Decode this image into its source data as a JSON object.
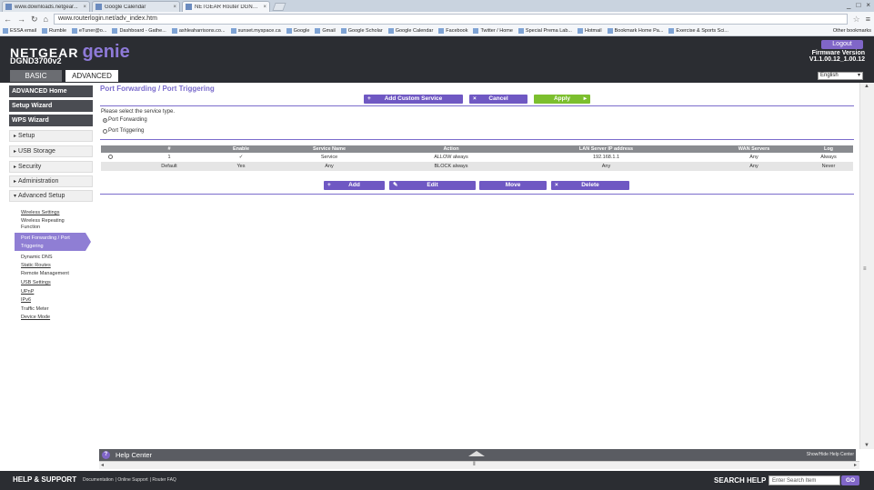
{
  "browser": {
    "tabs": [
      {
        "label": "www.downloads.netgear...",
        "active": false
      },
      {
        "label": "Google Calendar",
        "active": false
      },
      {
        "label": "NETGEAR Router DGND3...",
        "active": true
      }
    ],
    "window_controls": [
      "_",
      "□",
      "×"
    ],
    "url": "www.routerlogin.net/adv_index.htm",
    "bookmarks": [
      "ESSA email",
      "Rumble",
      "eTuner@o...",
      "Dashboard - Gathe...",
      "ashleaharrisons.co...",
      "sunset.myspace.ca",
      "Google",
      "Gmail",
      "Google Scholar",
      "Google Calendar",
      "Facebook",
      "Twitter / Home",
      "Special Prema Lab...",
      "Hotmail",
      "Bookmark Home Pa...",
      "Exercise & Sports Sci..."
    ],
    "bookmarks_other": "Other bookmarks"
  },
  "header": {
    "brand": "NETGEAR",
    "product": "genie",
    "model": "DGND3700v2",
    "logout": "Logout",
    "firmware_label": "Firmware Version",
    "firmware_version": "V1.1.00.12_1.00.12",
    "tabs": {
      "basic": "BASIC",
      "advanced": "ADVANCED"
    },
    "language": "English"
  },
  "sidebar": {
    "buttons": [
      "ADVANCED Home",
      "Setup Wizard",
      "WPS Wizard"
    ],
    "groups": [
      "Setup",
      "USB Storage",
      "Security",
      "Administration",
      "Advanced Setup"
    ],
    "links_top": [
      "Wireless Settings",
      "Wireless Repeating Function"
    ],
    "active_item": "Port Forwarding / Port Triggering",
    "links_bottom": [
      "Dynamic DNS",
      "Static Routes",
      "Remote Management",
      "USB Settings",
      "UPnP",
      "IPv6",
      "Traffic Meter",
      "Device Mode"
    ]
  },
  "main": {
    "title": "Port Forwarding / Port Triggering",
    "buttons": {
      "add_custom": "Add Custom Service",
      "cancel": "Cancel",
      "apply": "Apply"
    },
    "prompt": "Please select the service type.",
    "options": [
      {
        "label": "Port Forwarding",
        "selected": true
      },
      {
        "label": "Port Triggering",
        "selected": false
      }
    ],
    "table": {
      "headers": [
        "#",
        "Enable",
        "Service Name",
        "Action",
        "LAN Server IP address",
        "WAN Servers",
        "Log"
      ],
      "rows": [
        {
          "num": "1",
          "enable": "✓",
          "service": "Service",
          "action": "ALLOW always",
          "ip": "192.168.1.1",
          "wan": "Any",
          "log": "Always"
        },
        {
          "num": "Default",
          "enable": "Yes",
          "service": "Any",
          "action": "BLOCK always",
          "ip": "Any",
          "wan": "Any",
          "log": "Never"
        }
      ]
    },
    "actions": {
      "add": "Add",
      "edit": "Edit",
      "move": "Move",
      "delete": "Delete"
    }
  },
  "help": {
    "title": "Help Center",
    "toggle": "Show/Hide Help Center"
  },
  "footer": {
    "title": "HELP & SUPPORT",
    "links": [
      "Documentation",
      "Online Support",
      "Router FAQ"
    ],
    "search_label": "SEARCH HELP",
    "search_placeholder": "Enter Search Item",
    "go": "GO"
  },
  "colors": {
    "accent": "#6f58c3",
    "apply": "#7cbf2e",
    "header_bg": "#2b2d32"
  }
}
